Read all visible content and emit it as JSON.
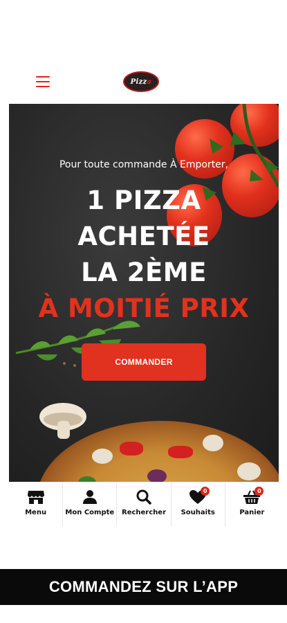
{
  "header": {
    "menu_icon": "hamburger-icon",
    "logo_text": "Pizza"
  },
  "hero": {
    "intro": "Pour toute commande À Emporter,",
    "line1": "1 PIZZA",
    "line2": "ACHETÉE",
    "line3": "LA 2ÈME",
    "line4": "À MOITIÉ PRIX",
    "cta_label": "COMMANDER",
    "accent_color": "#e0321e"
  },
  "tabs": [
    {
      "label": "Menu",
      "icon": "store-icon"
    },
    {
      "label": "Mon Compte",
      "icon": "user-icon"
    },
    {
      "label": "Rechercher",
      "icon": "search-icon"
    },
    {
      "label": "Souhaits",
      "icon": "heart-icon",
      "badge": "0"
    },
    {
      "label": "Panier",
      "icon": "basket-icon",
      "badge": "0"
    }
  ],
  "banner": {
    "text": "COMMANDEZ SUR L’APP"
  }
}
